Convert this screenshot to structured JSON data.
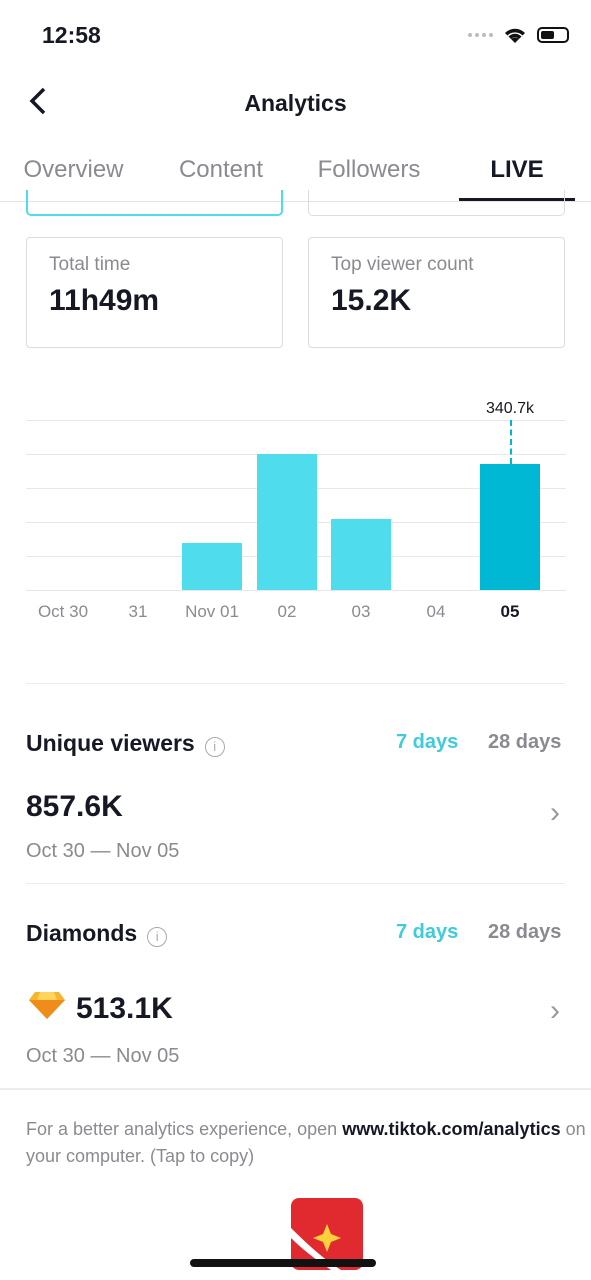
{
  "status": {
    "time": "12:58"
  },
  "header": {
    "title": "Analytics",
    "back_icon": "chevron-left-icon"
  },
  "tabs": [
    {
      "label": "Overview"
    },
    {
      "label": "Content"
    },
    {
      "label": "Followers"
    },
    {
      "label": "LIVE",
      "active": true
    }
  ],
  "stats": [
    {
      "label": "Total time",
      "value": "11h49m"
    },
    {
      "label": "Top viewer count",
      "value": "15.2K"
    }
  ],
  "chart_data": {
    "type": "bar",
    "categories": [
      "Oct 30",
      "31",
      "Nov 01",
      "02",
      "03",
      "04",
      "05"
    ],
    "values": [
      0,
      0,
      127,
      368,
      192,
      0,
      340.7
    ],
    "highlighted": "05",
    "highlight_label": "340.7k",
    "ylim": [
      0,
      460
    ],
    "grid": true,
    "colors": {
      "bar": "#4fdcec",
      "highlight": "#00b8d4"
    }
  },
  "unique_viewers": {
    "title": "Unique viewers",
    "range_7": "7 days",
    "range_28": "28 days",
    "value": "857.6K",
    "dates": "Oct 30 — Nov 05"
  },
  "diamonds": {
    "title": "Diamonds",
    "range_7": "7 days",
    "range_28": "28 days",
    "value": "513.1K",
    "dates": "Oct 30 — Nov 05",
    "icon": "diamond-icon"
  },
  "footer": {
    "text_before": "For a better analytics experience, open ",
    "link": "www.tiktok.com/analytics",
    "text_after": " on your computer. (Tap to copy)"
  },
  "colors": {
    "accent": "#3ecbdb"
  }
}
